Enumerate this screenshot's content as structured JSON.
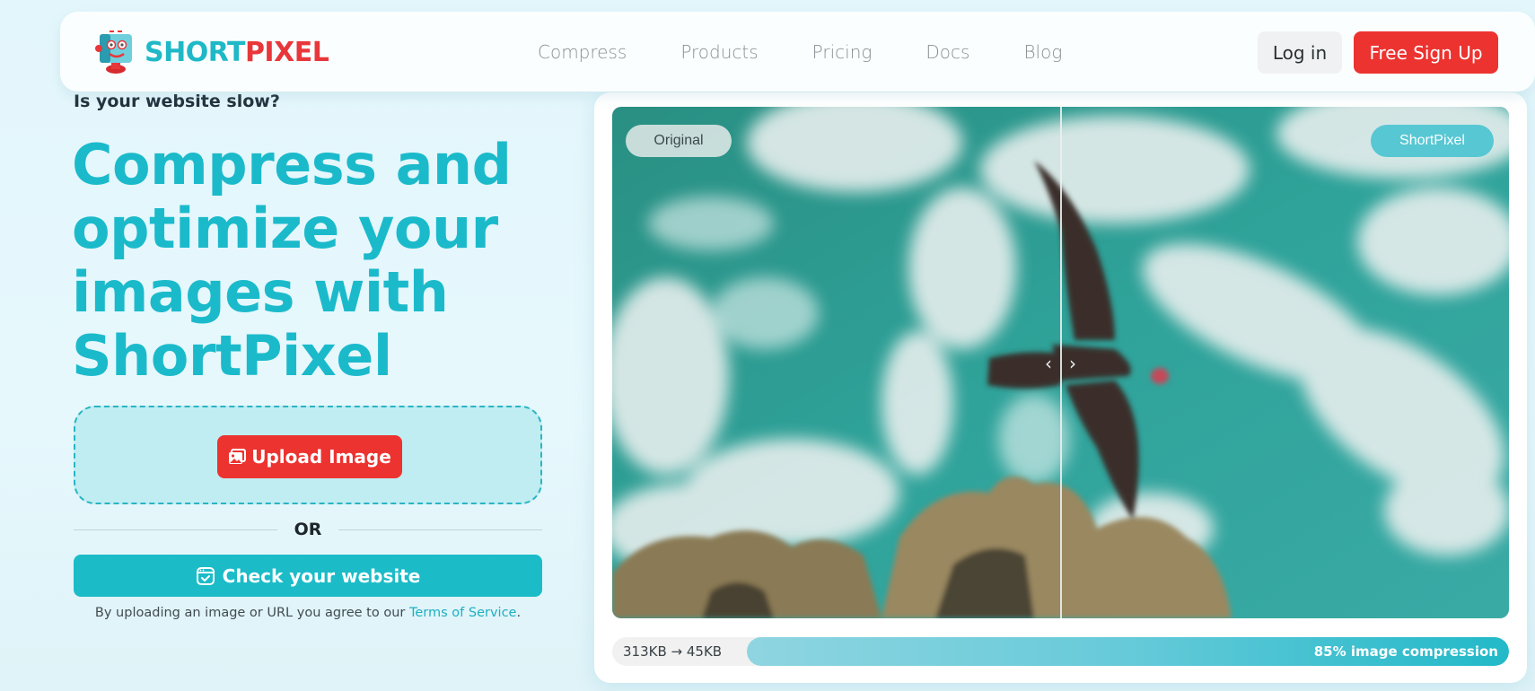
{
  "brand": {
    "name_part1": "SHORT",
    "name_part2": "PIXEL",
    "colors": {
      "teal": "#1bbacb",
      "red": "#ec3330"
    }
  },
  "nav": {
    "links": [
      "Compress",
      "Products",
      "Pricing",
      "Docs",
      "Blog"
    ],
    "login_label": "Log in",
    "signup_label": "Free Sign Up"
  },
  "hero": {
    "eyebrow": "Is your website slow?",
    "title_lines": [
      "Compress and",
      "optimize your",
      "images with",
      "ShortPixel"
    ],
    "upload_label": "Upload Image",
    "upload_icon": "image-icon",
    "or_label": "OR",
    "check_label": "Check your website",
    "check_icon": "browser-check-icon",
    "terms_prefix": "By uploading an image or URL you agree to our ",
    "terms_link": "Terms of Service",
    "terms_suffix": "."
  },
  "compare": {
    "label_original": "Original",
    "label_optimized": "ShortPixel",
    "divider_position": 0.5,
    "handle_icons": [
      "chevron-left-icon",
      "chevron-right-icon"
    ],
    "size_change": "313KB → 45KB",
    "compression_percent": 85,
    "compression_label": "85% image compression"
  }
}
